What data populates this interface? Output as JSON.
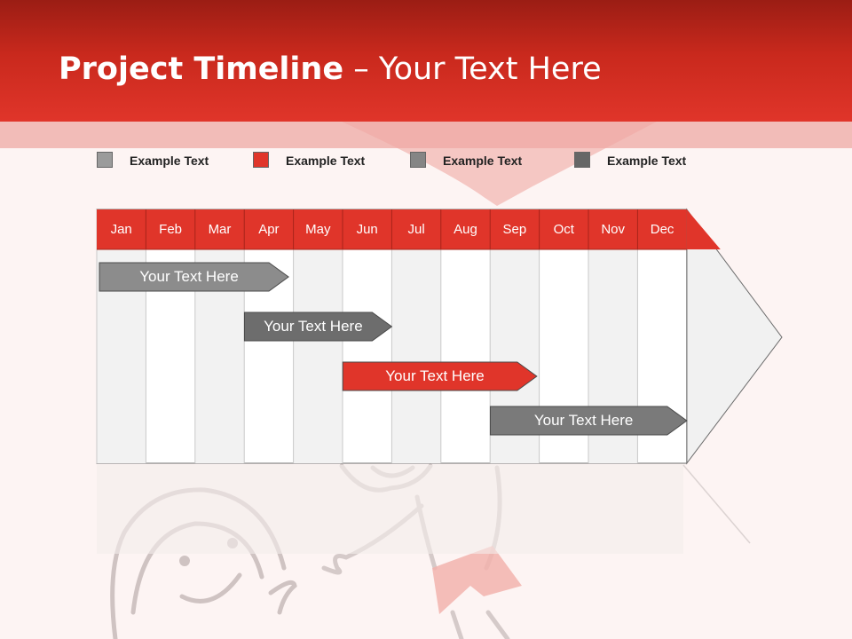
{
  "title": {
    "bold": "Project Timeline",
    "rest": " – Your Text Here"
  },
  "colors": {
    "red": "#e0352a",
    "gray_light": "#8c8c8c",
    "gray_dark": "#6d6d6d",
    "gray_mid": "#7a7a7a"
  },
  "legend": [
    {
      "label": "Example Text",
      "color": "#9b9b9b"
    },
    {
      "label": "Example Text",
      "color": "#e0352a"
    },
    {
      "label": "Example Text",
      "color": "#858585"
    },
    {
      "label": "Example Text",
      "color": "#666666"
    }
  ],
  "timeline": {
    "months": [
      "Jan",
      "Feb",
      "Mar",
      "Apr",
      "May",
      "Jun",
      "Jul",
      "Aug",
      "Sep",
      "Oct",
      "Nov",
      "Dec"
    ],
    "tasks": [
      {
        "label": "Your  Text Here",
        "start": 0,
        "end": 3.9,
        "color": "#8c8c8c"
      },
      {
        "label": "Your  Text Here",
        "start": 2.95,
        "end": 6,
        "color": "#6d6d6d"
      },
      {
        "label": "Your  Text Here",
        "start": 4.95,
        "end": 8.95,
        "color": "#e0352a"
      },
      {
        "label": "Your  Text Here",
        "start": 7.95,
        "end": 12,
        "color": "#7a7a7a"
      }
    ]
  }
}
